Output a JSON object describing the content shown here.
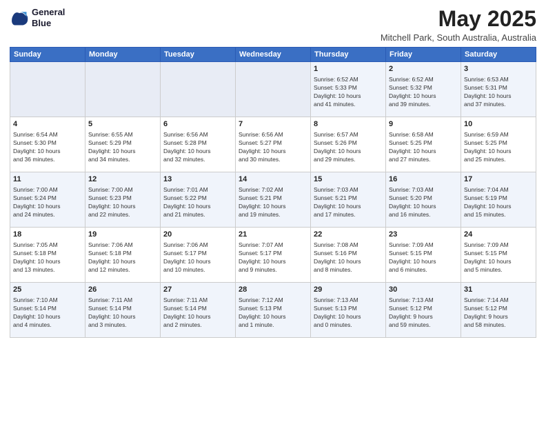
{
  "header": {
    "logo_line1": "General",
    "logo_line2": "Blue",
    "month": "May 2025",
    "location": "Mitchell Park, South Australia, Australia"
  },
  "days": [
    "Sunday",
    "Monday",
    "Tuesday",
    "Wednesday",
    "Thursday",
    "Friday",
    "Saturday"
  ],
  "weeks": [
    [
      {
        "date": "",
        "info": ""
      },
      {
        "date": "",
        "info": ""
      },
      {
        "date": "",
        "info": ""
      },
      {
        "date": "",
        "info": ""
      },
      {
        "date": "1",
        "info": "Sunrise: 6:52 AM\nSunset: 5:33 PM\nDaylight: 10 hours\nand 41 minutes."
      },
      {
        "date": "2",
        "info": "Sunrise: 6:52 AM\nSunset: 5:32 PM\nDaylight: 10 hours\nand 39 minutes."
      },
      {
        "date": "3",
        "info": "Sunrise: 6:53 AM\nSunset: 5:31 PM\nDaylight: 10 hours\nand 37 minutes."
      }
    ],
    [
      {
        "date": "4",
        "info": "Sunrise: 6:54 AM\nSunset: 5:30 PM\nDaylight: 10 hours\nand 36 minutes."
      },
      {
        "date": "5",
        "info": "Sunrise: 6:55 AM\nSunset: 5:29 PM\nDaylight: 10 hours\nand 34 minutes."
      },
      {
        "date": "6",
        "info": "Sunrise: 6:56 AM\nSunset: 5:28 PM\nDaylight: 10 hours\nand 32 minutes."
      },
      {
        "date": "7",
        "info": "Sunrise: 6:56 AM\nSunset: 5:27 PM\nDaylight: 10 hours\nand 30 minutes."
      },
      {
        "date": "8",
        "info": "Sunrise: 6:57 AM\nSunset: 5:26 PM\nDaylight: 10 hours\nand 29 minutes."
      },
      {
        "date": "9",
        "info": "Sunrise: 6:58 AM\nSunset: 5:25 PM\nDaylight: 10 hours\nand 27 minutes."
      },
      {
        "date": "10",
        "info": "Sunrise: 6:59 AM\nSunset: 5:25 PM\nDaylight: 10 hours\nand 25 minutes."
      }
    ],
    [
      {
        "date": "11",
        "info": "Sunrise: 7:00 AM\nSunset: 5:24 PM\nDaylight: 10 hours\nand 24 minutes."
      },
      {
        "date": "12",
        "info": "Sunrise: 7:00 AM\nSunset: 5:23 PM\nDaylight: 10 hours\nand 22 minutes."
      },
      {
        "date": "13",
        "info": "Sunrise: 7:01 AM\nSunset: 5:22 PM\nDaylight: 10 hours\nand 21 minutes."
      },
      {
        "date": "14",
        "info": "Sunrise: 7:02 AM\nSunset: 5:21 PM\nDaylight: 10 hours\nand 19 minutes."
      },
      {
        "date": "15",
        "info": "Sunrise: 7:03 AM\nSunset: 5:21 PM\nDaylight: 10 hours\nand 17 minutes."
      },
      {
        "date": "16",
        "info": "Sunrise: 7:03 AM\nSunset: 5:20 PM\nDaylight: 10 hours\nand 16 minutes."
      },
      {
        "date": "17",
        "info": "Sunrise: 7:04 AM\nSunset: 5:19 PM\nDaylight: 10 hours\nand 15 minutes."
      }
    ],
    [
      {
        "date": "18",
        "info": "Sunrise: 7:05 AM\nSunset: 5:18 PM\nDaylight: 10 hours\nand 13 minutes."
      },
      {
        "date": "19",
        "info": "Sunrise: 7:06 AM\nSunset: 5:18 PM\nDaylight: 10 hours\nand 12 minutes."
      },
      {
        "date": "20",
        "info": "Sunrise: 7:06 AM\nSunset: 5:17 PM\nDaylight: 10 hours\nand 10 minutes."
      },
      {
        "date": "21",
        "info": "Sunrise: 7:07 AM\nSunset: 5:17 PM\nDaylight: 10 hours\nand 9 minutes."
      },
      {
        "date": "22",
        "info": "Sunrise: 7:08 AM\nSunset: 5:16 PM\nDaylight: 10 hours\nand 8 minutes."
      },
      {
        "date": "23",
        "info": "Sunrise: 7:09 AM\nSunset: 5:15 PM\nDaylight: 10 hours\nand 6 minutes."
      },
      {
        "date": "24",
        "info": "Sunrise: 7:09 AM\nSunset: 5:15 PM\nDaylight: 10 hours\nand 5 minutes."
      }
    ],
    [
      {
        "date": "25",
        "info": "Sunrise: 7:10 AM\nSunset: 5:14 PM\nDaylight: 10 hours\nand 4 minutes."
      },
      {
        "date": "26",
        "info": "Sunrise: 7:11 AM\nSunset: 5:14 PM\nDaylight: 10 hours\nand 3 minutes."
      },
      {
        "date": "27",
        "info": "Sunrise: 7:11 AM\nSunset: 5:14 PM\nDaylight: 10 hours\nand 2 minutes."
      },
      {
        "date": "28",
        "info": "Sunrise: 7:12 AM\nSunset: 5:13 PM\nDaylight: 10 hours\nand 1 minute."
      },
      {
        "date": "29",
        "info": "Sunrise: 7:13 AM\nSunset: 5:13 PM\nDaylight: 10 hours\nand 0 minutes."
      },
      {
        "date": "30",
        "info": "Sunrise: 7:13 AM\nSunset: 5:12 PM\nDaylight: 9 hours\nand 59 minutes."
      },
      {
        "date": "31",
        "info": "Sunrise: 7:14 AM\nSunset: 5:12 PM\nDaylight: 9 hours\nand 58 minutes."
      }
    ]
  ]
}
